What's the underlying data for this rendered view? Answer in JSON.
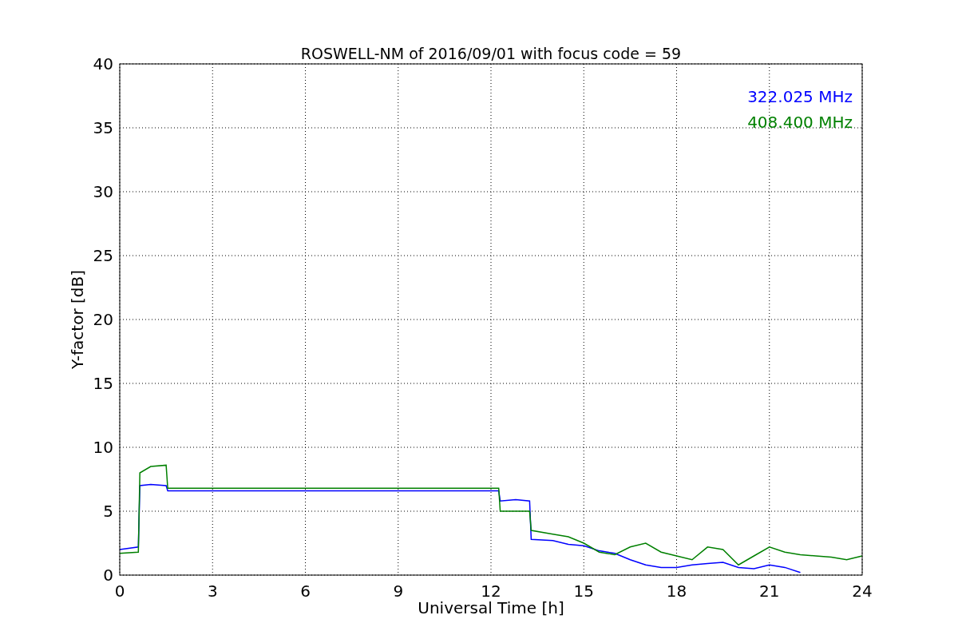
{
  "chart_data": {
    "type": "line",
    "title": "ROSWELL-NM of 2016/09/01 with focus code = 59",
    "xlabel": "Universal Time [h]",
    "ylabel": "Y-factor [dB]",
    "x": [
      0,
      0.6,
      0.65,
      1,
      1.5,
      1.55,
      3,
      6,
      9,
      12.25,
      12.3,
      12.8,
      13.25,
      13.3,
      14,
      14.5,
      15,
      15.5,
      16,
      16.5,
      17,
      17.5,
      18,
      18.5,
      19,
      19.5,
      20,
      20.5,
      21,
      21.5,
      22,
      22.5,
      23,
      23.5,
      24
    ],
    "series": [
      {
        "name": "322.025 MHz",
        "color": "#0000ff",
        "values": [
          2.0,
          2.2,
          7.0,
          7.1,
          7.0,
          6.6,
          6.6,
          6.6,
          6.6,
          6.6,
          5.8,
          5.9,
          5.8,
          2.8,
          2.7,
          2.4,
          2.3,
          1.9,
          1.7,
          1.2,
          0.8,
          0.6,
          0.6,
          0.8,
          0.9,
          1.0,
          0.6,
          0.5,
          0.8,
          0.6,
          0.2,
          null,
          null,
          null,
          null
        ]
      },
      {
        "name": "408.400 MHz",
        "color": "#008000",
        "values": [
          1.7,
          1.8,
          8.0,
          8.5,
          8.6,
          6.8,
          6.8,
          6.8,
          6.8,
          6.8,
          5.0,
          5.0,
          5.0,
          3.5,
          3.2,
          3.0,
          2.5,
          1.8,
          1.6,
          2.2,
          2.5,
          1.8,
          1.5,
          1.2,
          2.2,
          2.0,
          0.8,
          1.5,
          2.2,
          1.8,
          1.6,
          1.5,
          1.4,
          1.2,
          1.5
        ]
      }
    ],
    "grid": true,
    "xlim": [
      0,
      24
    ],
    "ylim": [
      0,
      40
    ],
    "xticks": [
      0,
      3,
      6,
      9,
      12,
      15,
      18,
      21,
      24
    ],
    "yticks": [
      0,
      5,
      10,
      15,
      20,
      25,
      30,
      35,
      40
    ]
  }
}
